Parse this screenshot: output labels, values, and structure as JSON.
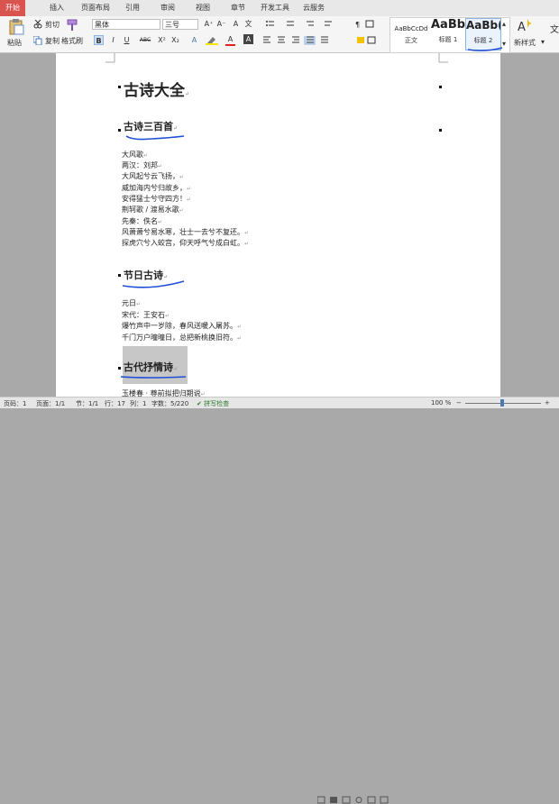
{
  "menu": {
    "tabs": [
      "开始",
      "插入",
      "页面布局",
      "引用",
      "审阅",
      "视图",
      "章节",
      "开发工具",
      "云服务"
    ]
  },
  "ribbon": {
    "paste": "粘贴",
    "cut": "剪切",
    "copy": "复制",
    "format_painter": "格式刷",
    "font_name": "黑体",
    "font_size": "三号",
    "styles": [
      {
        "sample": "AaBbCcDd",
        "name": "正文"
      },
      {
        "sample": "AaBb",
        "name": "标题 1"
      },
      {
        "sample": "AaBb(",
        "name": "标题 2"
      }
    ],
    "new_style": "新样式",
    "new_style_caret": "▾",
    "bold": "B",
    "italic": "I",
    "underline": "U",
    "strike": "ABC",
    "superscript": "X²",
    "subscript": "X₂",
    "font_color": "A",
    "highlight": "A",
    "clear": "A",
    "grow": "A⁺",
    "shrink": "A⁻",
    "wen": "文"
  },
  "document": {
    "title": "古诗大全",
    "sections": [
      {
        "heading": "古诗三百首",
        "lines": [
          "大风歌",
          "两汉：刘邦",
          "大风起兮云飞扬，",
          "威加海内兮归故乡，",
          "安得猛士兮守四方！",
          "荆轲歌 / 渡易水歌",
          "先秦：佚名",
          "风萧萧兮易水寒，壮士一去兮不复还。",
          "探虎穴兮入蛟宫，仰天呼气兮成白虹。"
        ]
      },
      {
        "heading": "节日古诗",
        "lines": [
          "元日",
          "宋代：王安石",
          "爆竹声中一岁除，春风送暖入屠苏。",
          "千门万户曈曈日，总把新桃换旧符。"
        ]
      },
      {
        "heading": "古代抒情诗",
        "lines": [
          "玉楼春 · 尊前拟把归期说"
        ]
      }
    ],
    "para_mark": "↵"
  },
  "status": {
    "page_num": "页码：1",
    "pages": "页面：1/1",
    "section": "节：1/1",
    "row": "行：17",
    "col": "列：1",
    "words": "字数：5/220",
    "spell": "拼写检查",
    "zoom": "100 %"
  },
  "colors": {
    "accent": "#d9534f",
    "annotation_blue": "#1f4fd6"
  }
}
